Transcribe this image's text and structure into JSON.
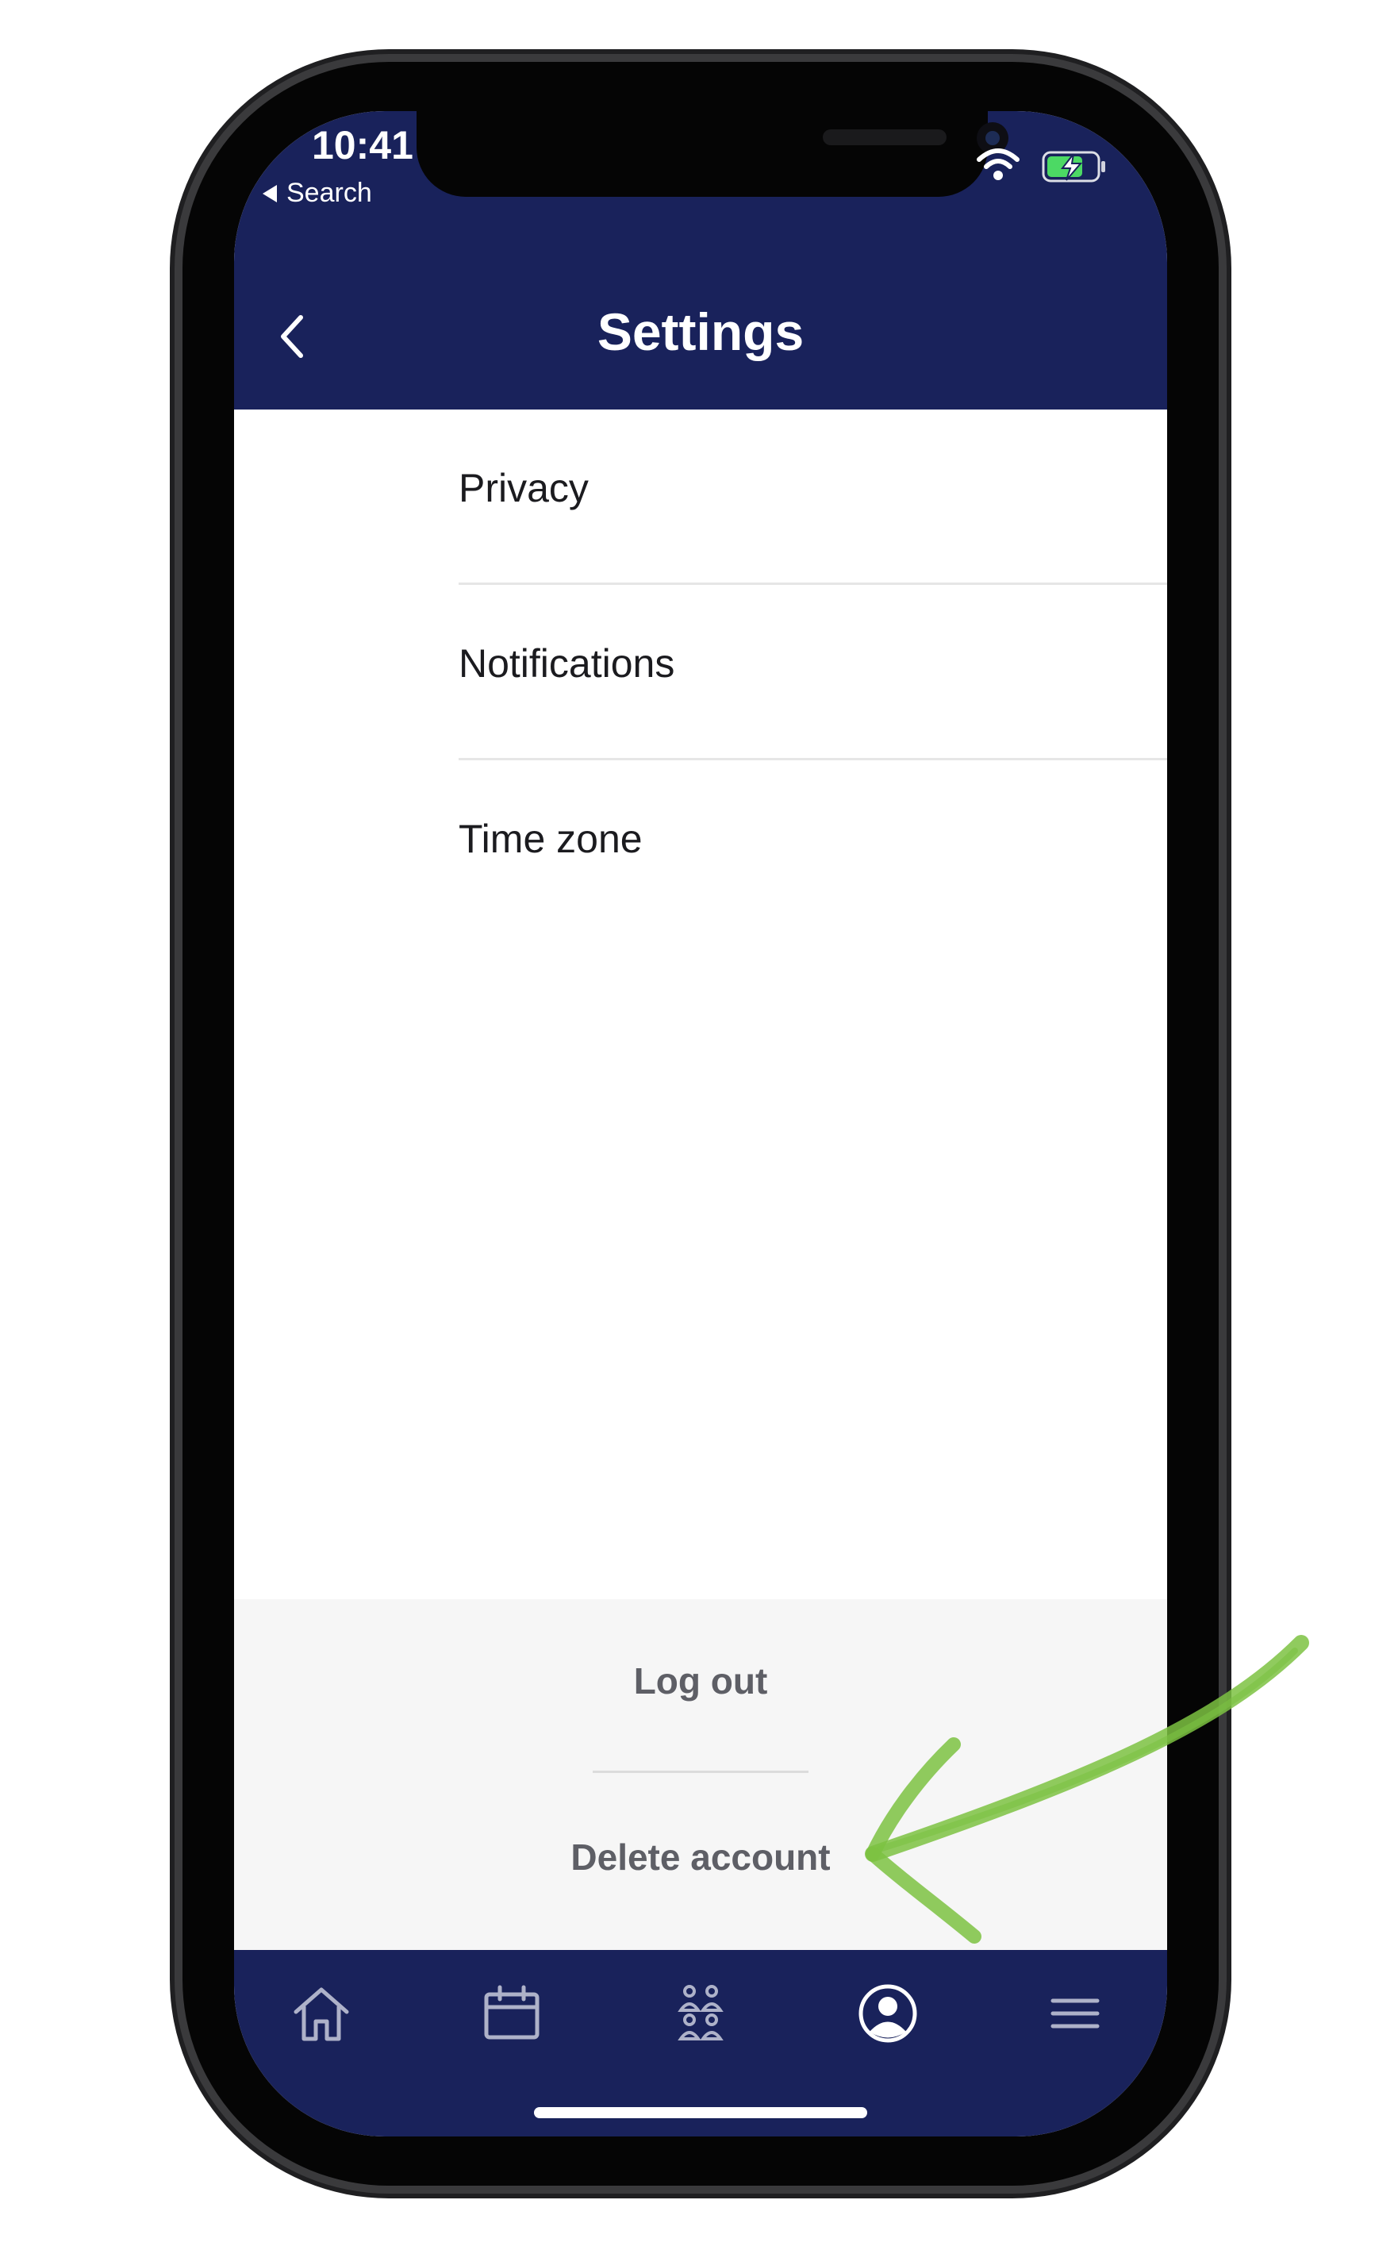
{
  "colors": {
    "brand_navy": "#19225b",
    "action_gray": "#5e5f66",
    "annotation_green": "#7cc242",
    "battery_green": "#4cd964"
  },
  "status_bar": {
    "time": "10:41",
    "back_app": "Search"
  },
  "nav": {
    "title": "Settings",
    "back_icon": "chevron-left-icon"
  },
  "settings_items": [
    {
      "label": "Privacy"
    },
    {
      "label": "Notifications"
    },
    {
      "label": "Time zone"
    }
  ],
  "actions": {
    "logout": "Log out",
    "delete_account": "Delete account"
  },
  "tabbar": {
    "tabs": [
      {
        "icon": "home-icon",
        "active": false
      },
      {
        "icon": "calendar-icon",
        "active": false
      },
      {
        "icon": "people-icon",
        "active": false
      },
      {
        "icon": "profile-icon",
        "active": true
      },
      {
        "icon": "menu-icon",
        "active": false
      }
    ]
  }
}
